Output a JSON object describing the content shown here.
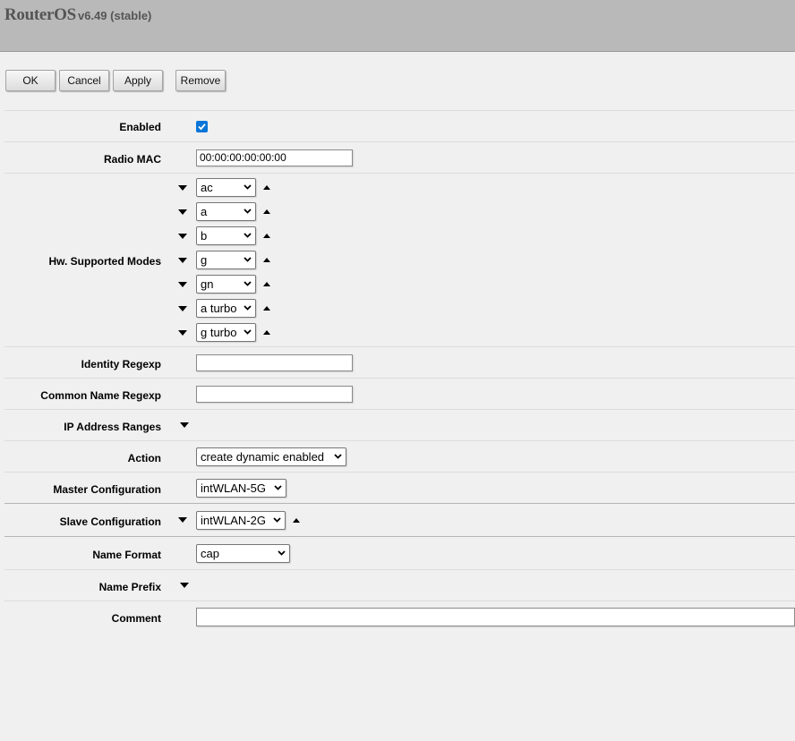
{
  "app": {
    "brand": "RouterOS",
    "version": "v6.49 (stable)"
  },
  "toolbar": {
    "ok": "OK",
    "cancel": "Cancel",
    "apply": "Apply",
    "remove": "Remove"
  },
  "fields": {
    "enabled": {
      "label": "Enabled",
      "checked": true
    },
    "radio_mac": {
      "label": "Radio MAC",
      "value": "00:00:00:00:00:00"
    },
    "hw_modes": {
      "label": "Hw. Supported Modes",
      "values": [
        "ac",
        "a",
        "b",
        "g",
        "gn",
        "a turbo",
        "g turbo"
      ]
    },
    "identity_regexp": {
      "label": "Identity Regexp",
      "value": ""
    },
    "common_name_regexp": {
      "label": "Common Name Regexp",
      "value": ""
    },
    "ip_address_ranges": {
      "label": "IP Address Ranges"
    },
    "action": {
      "label": "Action",
      "value": "create dynamic enabled"
    },
    "master_configuration": {
      "label": "Master Configuration",
      "value": "intWLAN-5G"
    },
    "slave_configuration": {
      "label": "Slave Configuration",
      "value": "intWLAN-2G"
    },
    "name_format": {
      "label": "Name Format",
      "value": "cap"
    },
    "name_prefix": {
      "label": "Name Prefix"
    },
    "comment": {
      "label": "Comment",
      "value": ""
    }
  }
}
